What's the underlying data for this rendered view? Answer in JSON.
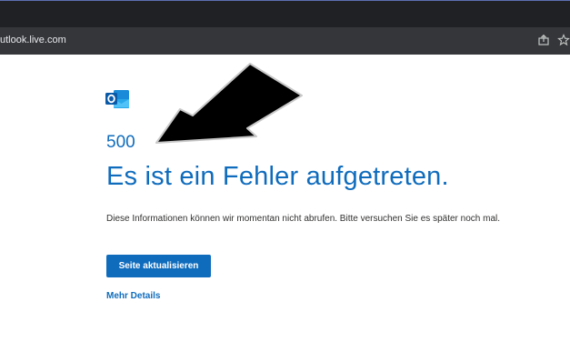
{
  "browser": {
    "url": "utlook.live.com",
    "icons": [
      "share-icon",
      "star-icon"
    ]
  },
  "error_page": {
    "logo_icon": "outlook-logo-icon",
    "code": "500",
    "headline": "Es ist ein Fehler aufgetreten.",
    "description": "Diese Informationen können wir momentan nicht abrufen. Bitte versuchen Sie es später noch mal.",
    "refresh_button": "Seite aktualisieren",
    "details_link": "Mehr Details"
  },
  "colors": {
    "accent": "#0f6cbd",
    "browser_dark": "#35363a",
    "annotation_arrow": "#000000"
  }
}
